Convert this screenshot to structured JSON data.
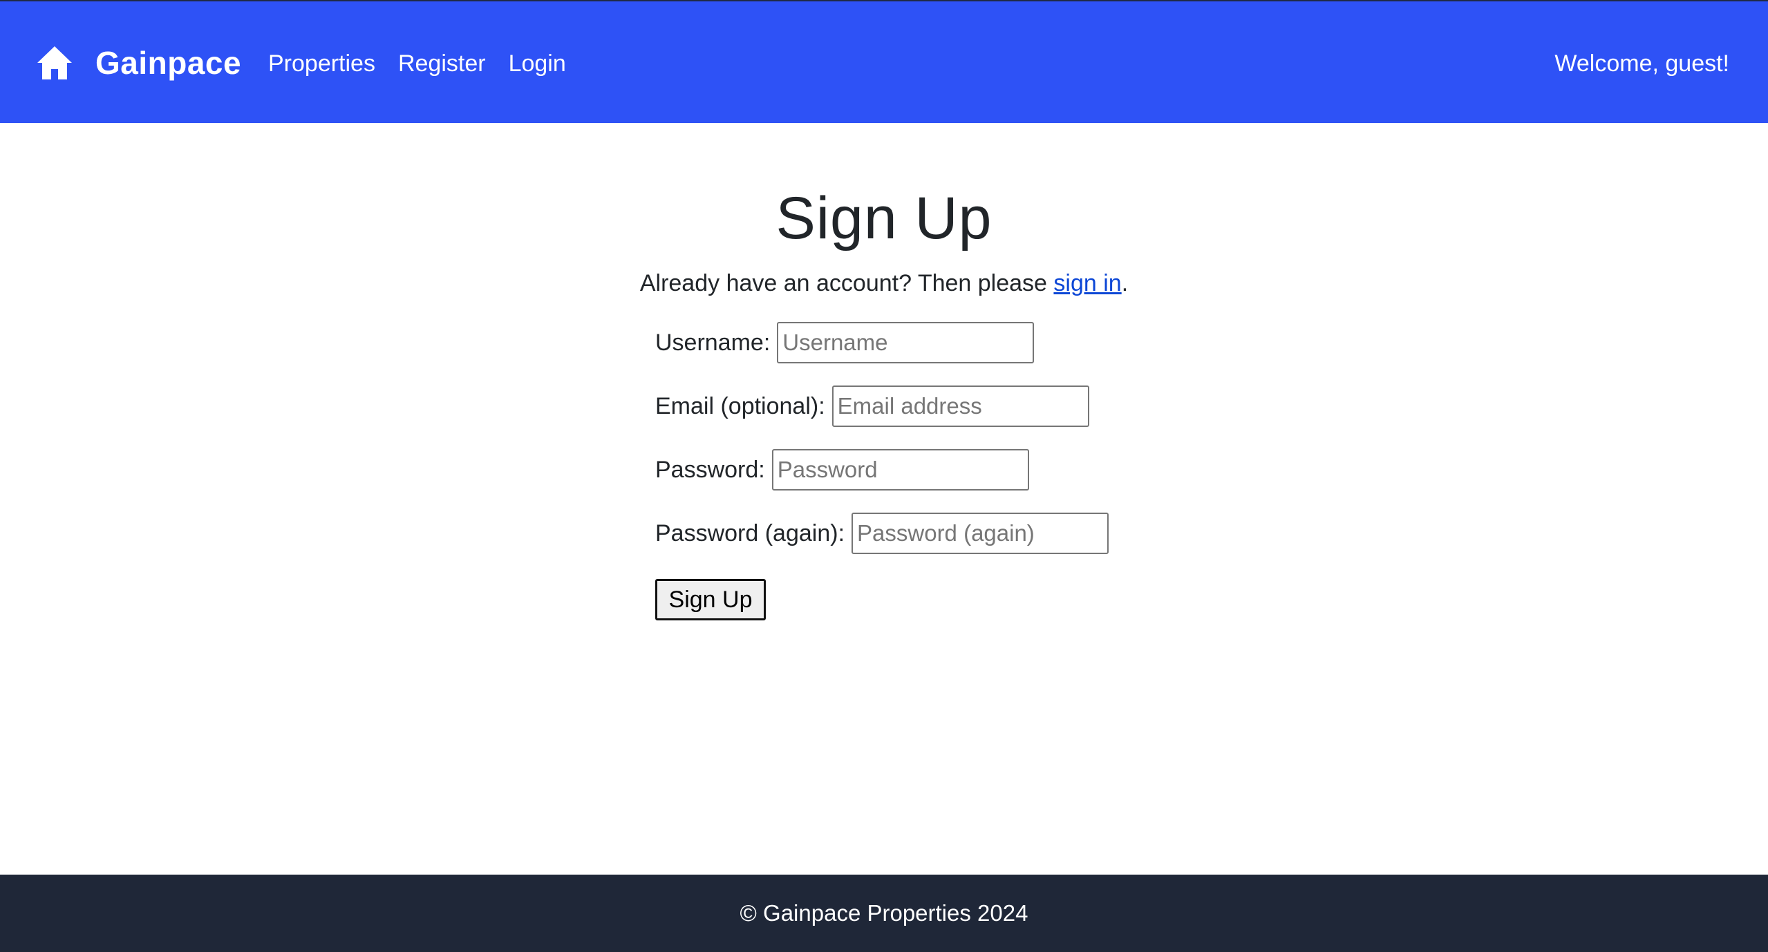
{
  "navbar": {
    "brand_icon": "home-icon",
    "brand_name": "Gainpace",
    "links": [
      {
        "label": "Properties"
      },
      {
        "label": "Register"
      },
      {
        "label": "Login"
      }
    ],
    "welcome_text": "Welcome, guest!",
    "background_color": "#2e52f6"
  },
  "main": {
    "title": "Sign Up",
    "intro_prefix": "Already have an account? Then please ",
    "intro_link": "sign in",
    "intro_suffix": ".",
    "form": {
      "fields": [
        {
          "label": "Username:",
          "placeholder": "Username",
          "value": ""
        },
        {
          "label": "Email (optional):",
          "placeholder": "Email address",
          "value": ""
        },
        {
          "label": "Password:",
          "placeholder": "Password",
          "value": ""
        },
        {
          "label": "Password (again):",
          "placeholder": "Password (again)",
          "value": ""
        }
      ],
      "submit_label": "Sign Up"
    }
  },
  "footer": {
    "text": "© Gainpace Properties 2024",
    "background_color": "#1f2738"
  }
}
